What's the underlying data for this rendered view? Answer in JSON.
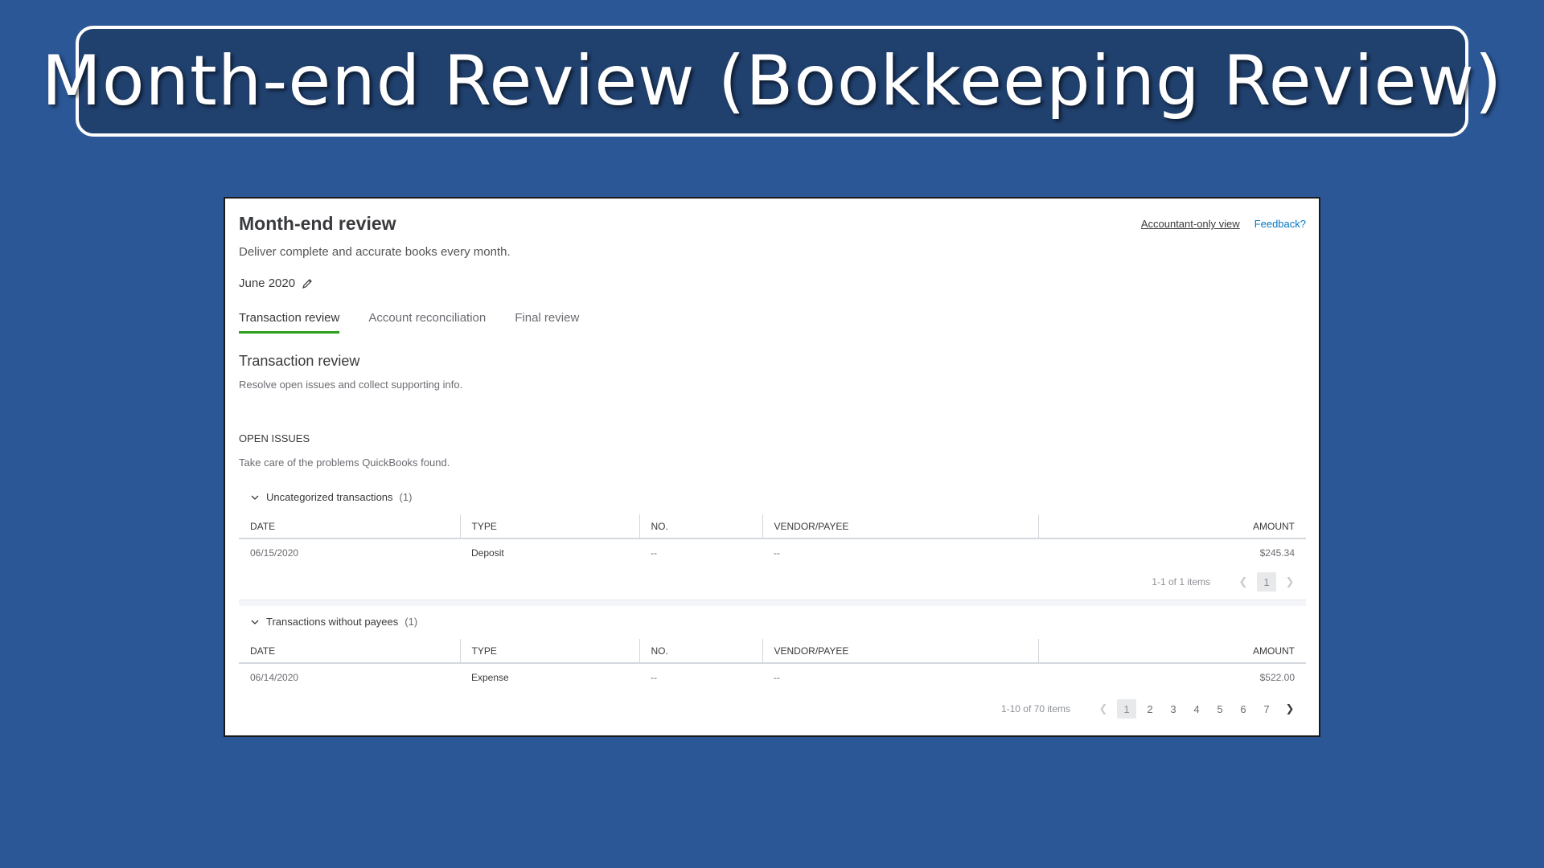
{
  "slide": {
    "title": "Month-end Review (Bookkeeping Review)"
  },
  "header": {
    "title": "Month-end review",
    "subtitle": "Deliver complete and accurate books every month.",
    "accountant_view": "Accountant-only view",
    "feedback": "Feedback?",
    "period": "June 2020"
  },
  "tabs": [
    {
      "label": "Transaction review",
      "active": true
    },
    {
      "label": "Account reconciliation",
      "active": false
    },
    {
      "label": "Final review",
      "active": false
    }
  ],
  "section": {
    "title": "Transaction review",
    "subtitle": "Resolve open issues and collect supporting info.",
    "issues_label": "OPEN ISSUES",
    "issues_subtitle": "Take care of the problems QuickBooks found."
  },
  "columns": {
    "date": "DATE",
    "type": "TYPE",
    "no": "NO.",
    "vendor": "VENDOR/PAYEE",
    "amount": "AMOUNT"
  },
  "groups": [
    {
      "title": "Uncategorized transactions",
      "count": "(1)",
      "rows": [
        {
          "date": "06/15/2020",
          "type": "Deposit",
          "no": "--",
          "vendor": "--",
          "amount": "$245.34"
        }
      ],
      "pager": {
        "info": "1-1 of 1 items",
        "pages": [
          "1"
        ]
      }
    },
    {
      "title": "Transactions without payees",
      "count": "(1)",
      "rows": [
        {
          "date": "06/14/2020",
          "type": "Expense",
          "no": "--",
          "vendor": "--",
          "amount": "$522.00"
        }
      ],
      "pager": {
        "info": "1-10 of 70 items",
        "pages": [
          "1",
          "2",
          "3",
          "4",
          "5",
          "6",
          "7"
        ]
      }
    }
  ],
  "colors": {
    "background": "#2b5797",
    "accent_tab": "#2ca01c",
    "link": "#0077c5"
  }
}
